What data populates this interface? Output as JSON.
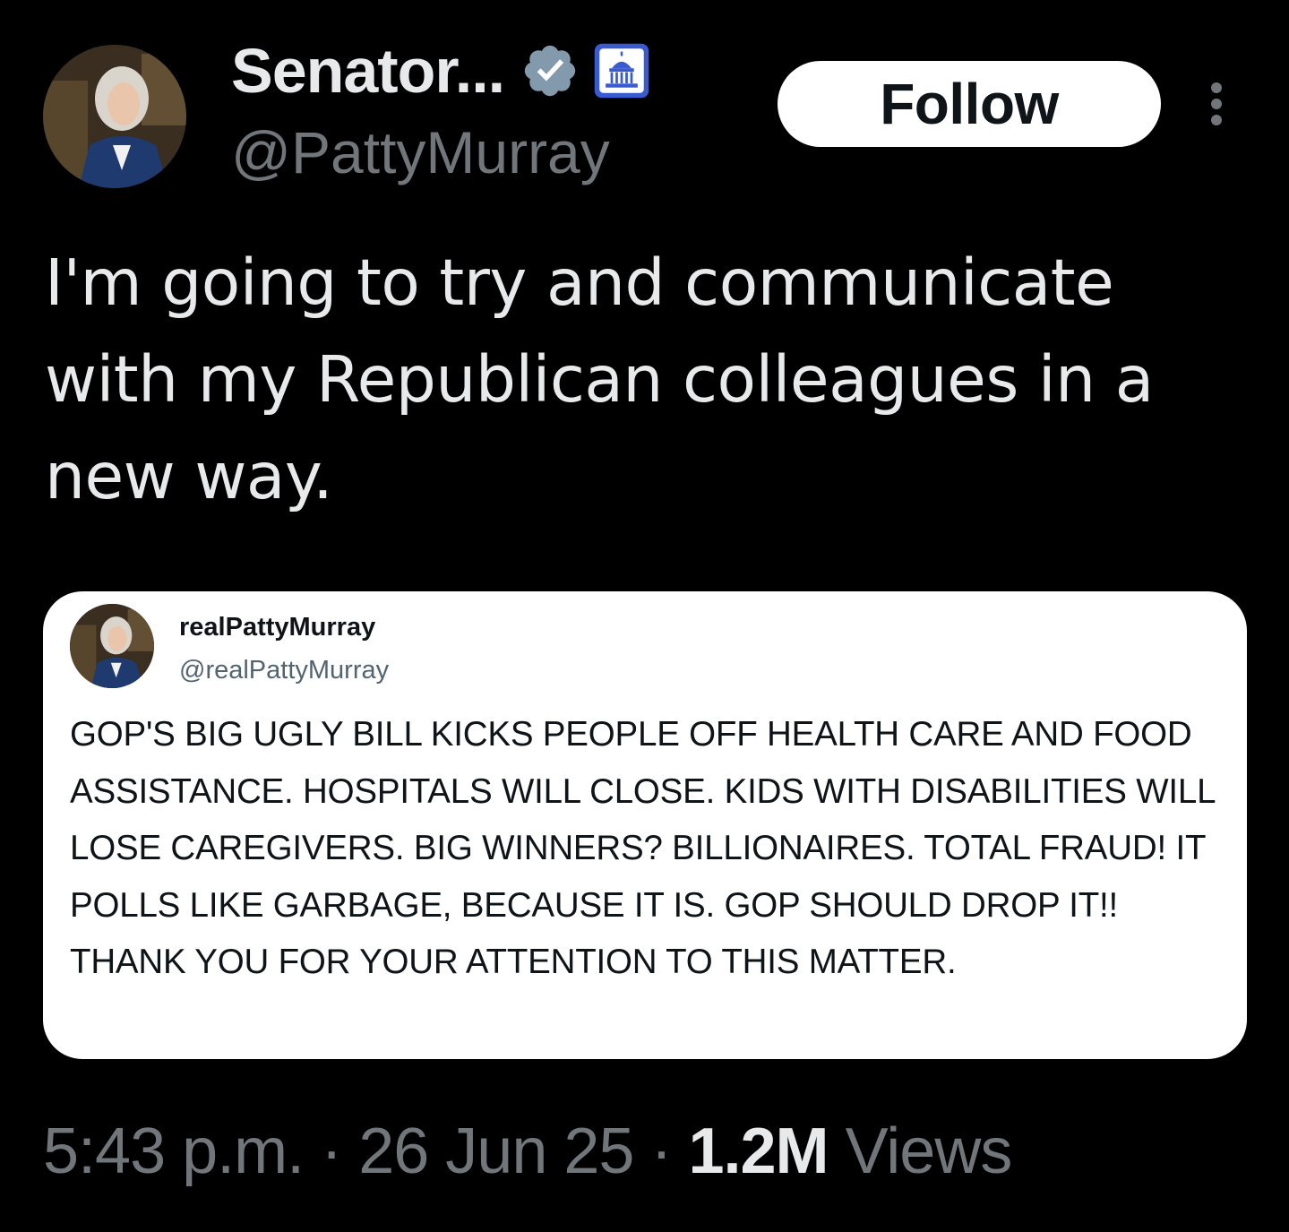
{
  "author": {
    "display_name": "Senator...",
    "handle": "@PattyMurray",
    "verified_badge_color": "#829aab",
    "gov_badge_color": "#3a5bd0"
  },
  "actions": {
    "follow_label": "Follow"
  },
  "tweet": {
    "text": "I'm going to try and communicate with my Republican colleagues in a new way."
  },
  "quote": {
    "display_name": "realPattyMurray",
    "handle": "@realPattyMurray",
    "text": "GOP'S BIG UGLY BILL KICKS PEOPLE OFF HEALTH CARE AND FOOD ASSISTANCE. HOSPITALS WILL CLOSE. KIDS WITH DISABILITIES WILL LOSE CAREGIVERS. BIG WINNERS? BILLIONAIRES. TOTAL FRAUD! IT POLLS LIKE GARBAGE, BECAUSE IT IS. GOP SHOULD DROP IT!! THANK YOU FOR YOUR ATTENTION TO THIS MATTER."
  },
  "meta": {
    "time": "5:43 p.m.",
    "separator": "·",
    "date": "26 Jun 25",
    "views_count": "1.2M",
    "views_label": "Views"
  },
  "theme": {
    "background": "#000000",
    "text_primary": "#e7e9ea",
    "text_secondary": "#71767b"
  }
}
